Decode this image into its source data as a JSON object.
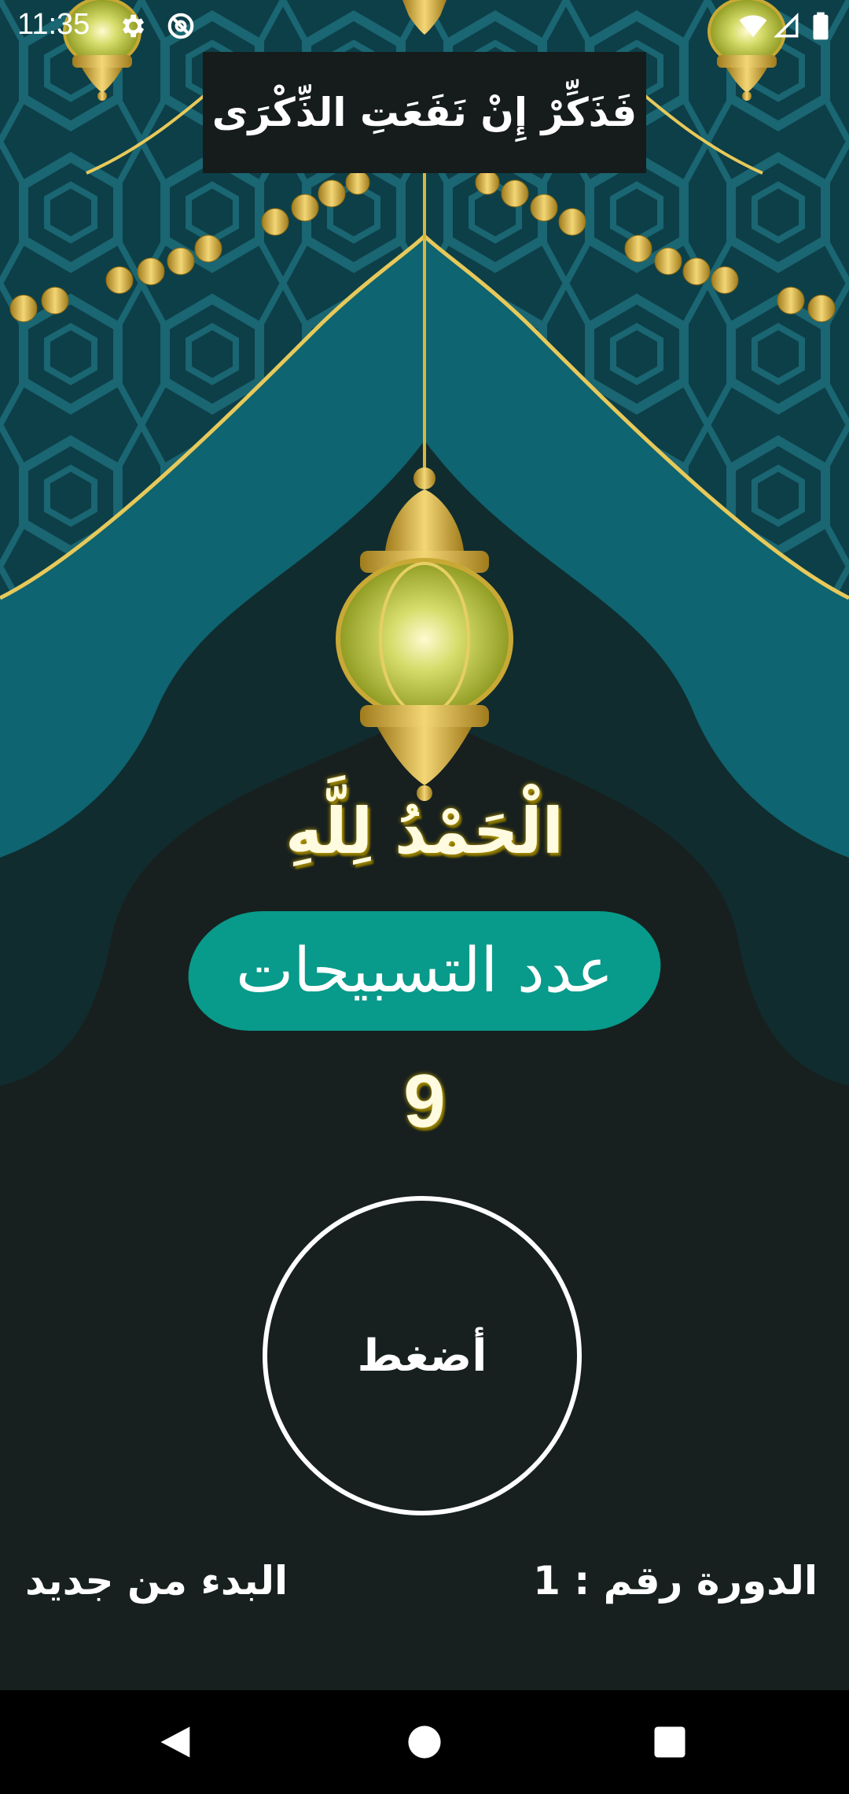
{
  "status_bar": {
    "time": "11:35",
    "icons": [
      "settings-gear-icon",
      "no-sync-icon",
      "wifi-icon",
      "cell-signal-icon",
      "battery-icon"
    ]
  },
  "header": {
    "verse": "فَذَكِّرْ إِنْ نَفَعَتِ الذِّكْرَى"
  },
  "dhikr": {
    "text": "الْحَمْدُ لِلَّهِ"
  },
  "counter": {
    "label": "عدد التسبيحات",
    "value": "9"
  },
  "press_button": {
    "label": "أضغط"
  },
  "footer": {
    "restart_label": "البدء من جديد",
    "round_label": "الدورة رقم : 1"
  },
  "nav": {
    "icons": [
      "back-triangle-icon",
      "home-circle-icon",
      "recents-square-icon"
    ]
  },
  "colors": {
    "background": "#17201f",
    "teal": "#0e6470",
    "pill": "#089a8a",
    "gold": "#d9b640",
    "glow": "#c8a600"
  }
}
